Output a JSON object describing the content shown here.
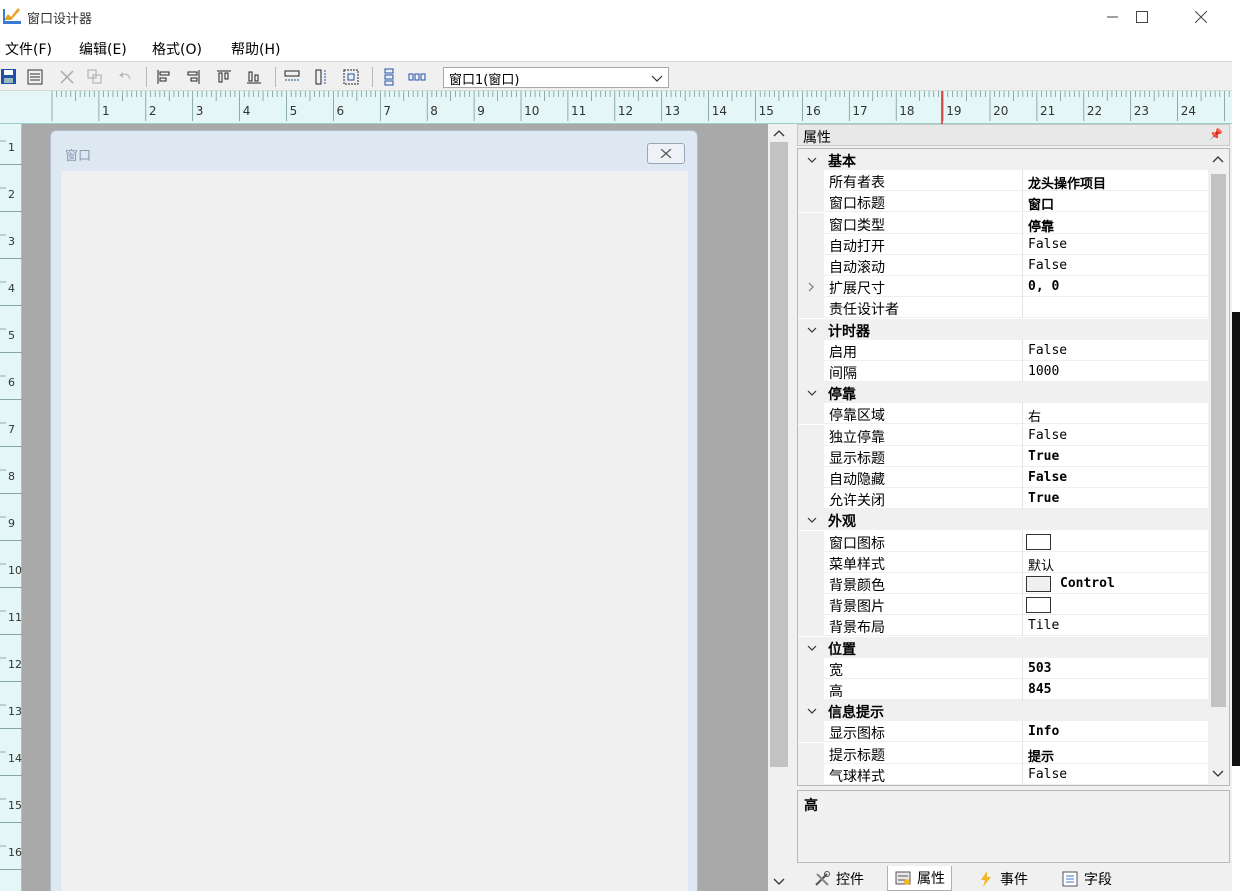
{
  "window": {
    "title": "窗口设计器"
  },
  "menu": [
    {
      "label": "文件(F)"
    },
    {
      "label": "编辑(E)"
    },
    {
      "label": "格式(O)"
    },
    {
      "label": "帮助(H)"
    }
  ],
  "toolbar": {
    "object_selector": "窗口1(窗口)",
    "icons": [
      "save-icon",
      "properties-icon",
      "delete-icon",
      "copy-icon",
      "undo-icon",
      "align-left-icon",
      "align-right-icon",
      "align-top-icon",
      "align-bottom-icon",
      "same-width-icon",
      "same-height-icon",
      "same-size-icon",
      "vertical-spacing-icon",
      "horizontal-spacing-icon"
    ]
  },
  "ruler": {
    "h_labels": [
      "1",
      "2",
      "3",
      "4",
      "5",
      "6",
      "7",
      "8",
      "9",
      "10",
      "11",
      "12",
      "13",
      "14",
      "15",
      "16",
      "17",
      "18",
      "19",
      "20",
      "21",
      "22",
      "23",
      "24"
    ],
    "v_labels": [
      "1",
      "2",
      "3",
      "4",
      "5",
      "6",
      "7",
      "8",
      "9",
      "10",
      "11",
      "12",
      "13",
      "14",
      "15",
      "16"
    ]
  },
  "form": {
    "title": "窗口"
  },
  "properties_panel": {
    "title": "属性",
    "categories": [
      {
        "name": "基本",
        "items": [
          {
            "name": "所有者表",
            "value": "龙头操作项目",
            "bold": true
          },
          {
            "name": "窗口标题",
            "value": "窗口",
            "bold": true
          },
          {
            "name": "窗口类型",
            "value": "停靠",
            "bold": true
          },
          {
            "name": "自动打开",
            "value": "False",
            "bold": false
          },
          {
            "name": "自动滚动",
            "value": "False",
            "bold": false
          },
          {
            "name": "扩展尺寸",
            "value": "0, 0",
            "bold": true,
            "expandable": true
          },
          {
            "name": "责任设计者",
            "value": "",
            "bold": false
          }
        ]
      },
      {
        "name": "计时器",
        "items": [
          {
            "name": "启用",
            "value": "False",
            "bold": false
          },
          {
            "name": "间隔",
            "value": "1000",
            "bold": false
          }
        ]
      },
      {
        "name": "停靠",
        "items": [
          {
            "name": "停靠区域",
            "value": "右",
            "bold": false
          },
          {
            "name": "独立停靠",
            "value": "False",
            "bold": false
          },
          {
            "name": "显示标题",
            "value": "True",
            "bold": true
          },
          {
            "name": "自动隐藏",
            "value": "False",
            "bold": true
          },
          {
            "name": "允许关闭",
            "value": "True",
            "bold": true
          }
        ]
      },
      {
        "name": "外观",
        "items": [
          {
            "name": "窗口图标",
            "value": "",
            "swatch": "white"
          },
          {
            "name": "菜单样式",
            "value": "默认",
            "bold": false
          },
          {
            "name": "背景颜色",
            "value": "Control",
            "swatch": "gray"
          },
          {
            "name": "背景图片",
            "value": "",
            "swatch": "white"
          },
          {
            "name": "背景布局",
            "value": "Tile",
            "bold": false
          }
        ]
      },
      {
        "name": "位置",
        "items": [
          {
            "name": "宽",
            "value": "503",
            "bold": true
          },
          {
            "name": "高",
            "value": "845",
            "bold": true
          }
        ]
      },
      {
        "name": "信息提示",
        "items": [
          {
            "name": "显示图标",
            "value": "Info",
            "bold": true
          },
          {
            "name": "提示标题",
            "value": "提示",
            "bold": true
          },
          {
            "name": "气球样式",
            "value": "False",
            "bold": false
          }
        ]
      }
    ],
    "description": "高"
  },
  "tabs": [
    {
      "label": "控件",
      "icon": "tools-icon"
    },
    {
      "label": "属性",
      "icon": "properties-icon",
      "active": true
    },
    {
      "label": "事件",
      "icon": "lightning-icon"
    },
    {
      "label": "字段",
      "icon": "field-list-icon"
    }
  ]
}
